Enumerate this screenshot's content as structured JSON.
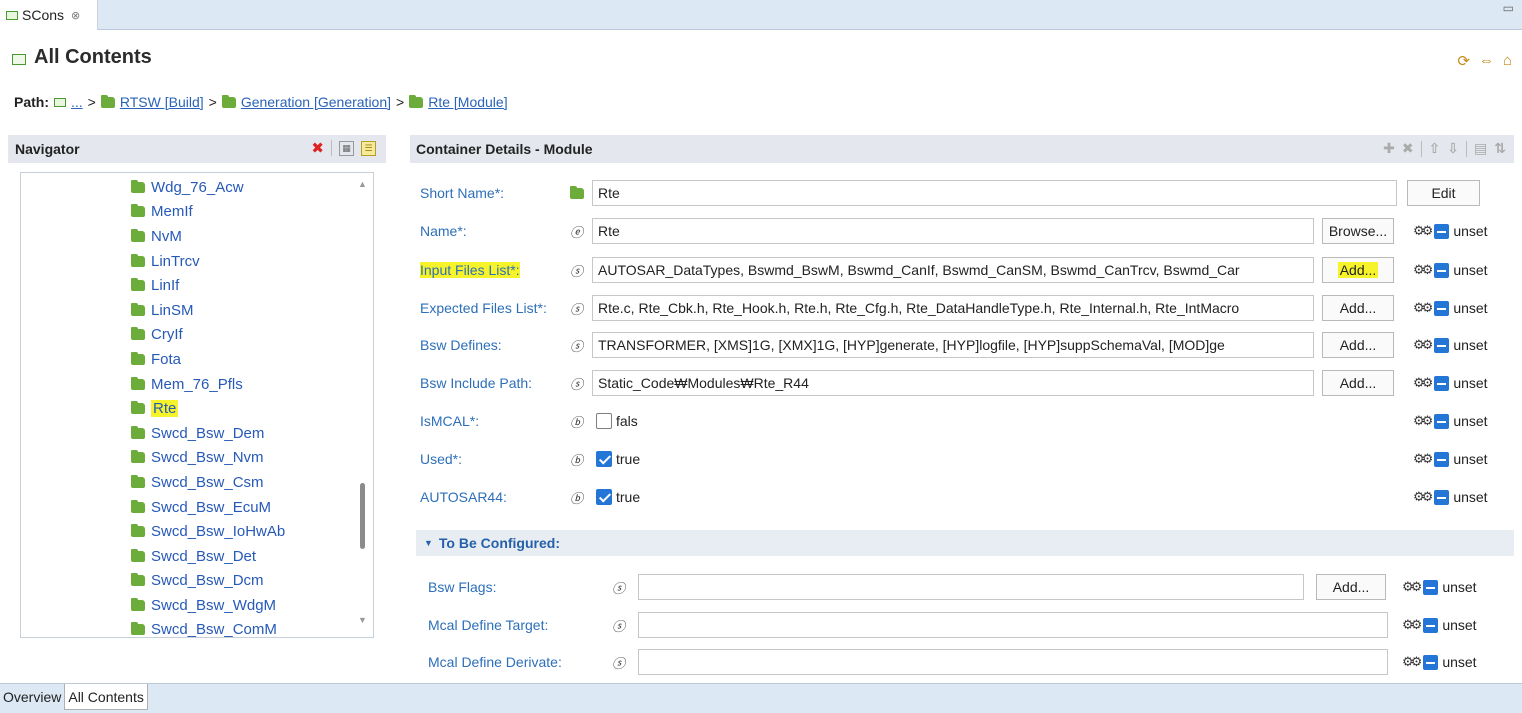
{
  "editor_tab": {
    "label": "SCons",
    "close": "⊗"
  },
  "title": "All Contents",
  "path": {
    "label": "Path:",
    "crumbs": [
      "...",
      "RTSW [Build]",
      "Generation [Generation]",
      "Rte [Module]"
    ],
    "separator": ">"
  },
  "navigator": {
    "title": "Navigator",
    "items": [
      "Wdg_76_Acw",
      "MemIf",
      "NvM",
      "LinTrcv",
      "LinIf",
      "LinSM",
      "CryIf",
      "Fota",
      "Mem_76_Pfls",
      "Rte",
      "Swcd_Bsw_Dem",
      "Swcd_Bsw_Nvm",
      "Swcd_Bsw_Csm",
      "Swcd_Bsw_EcuM",
      "Swcd_Bsw_IoHwAb",
      "Swcd_Bsw_Det",
      "Swcd_Bsw_Dcm",
      "Swcd_Bsw_WdgM",
      "Swcd_Bsw_ComM"
    ],
    "selected_index": 9
  },
  "details": {
    "title": "Container Details - Module",
    "unset_label": "unset",
    "fields": [
      {
        "label": "Short Name*:",
        "type_icon": "folder",
        "value": "Rte",
        "button": "Edit"
      },
      {
        "label": "Name*:",
        "type_icon": "ⓔ",
        "value": "Rte",
        "button": "Browse..."
      },
      {
        "label": "Input Files List*:",
        "type_icon": "ⓢ",
        "value": "AUTOSAR_DataTypes, Bswmd_BswM, Bswmd_CanIf, Bswmd_CanSM, Bswmd_CanTrcv, Bswmd_Car",
        "button": "Add..."
      },
      {
        "label": "Expected Files List*:",
        "type_icon": "ⓢ",
        "value": "Rte.c, Rte_Cbk.h, Rte_Hook.h, Rte.h, Rte_Cfg.h, Rte_DataHandleType.h, Rte_Internal.h, Rte_IntMacro",
        "button": "Add..."
      },
      {
        "label": "Bsw Defines:",
        "type_icon": "ⓢ",
        "value": "TRANSFORMER, [XMS]1G, [XMX]1G, [HYP]generate, [HYP]logfile, [HYP]suppSchemaVal, [MOD]ge",
        "button": "Add..."
      },
      {
        "label": "Bsw Include Path:",
        "type_icon": "ⓢ",
        "value": "Static_Code₩Modules₩Rte_R44",
        "button": "Add..."
      },
      {
        "label": "IsMCAL*:",
        "type_icon": "ⓑ",
        "checked": false,
        "value": "fals"
      },
      {
        "label": "Used*:",
        "type_icon": "ⓑ",
        "checked": true,
        "value": "true"
      },
      {
        "label": "AUTOSAR44:",
        "type_icon": "ⓑ",
        "checked": true,
        "value": "true"
      }
    ],
    "section": "To Be Configured:",
    "configured_fields": [
      {
        "label": "Bsw Flags:",
        "type_icon": "ⓢ",
        "value": "",
        "button": "Add..."
      },
      {
        "label": "Mcal Define Target:",
        "type_icon": "ⓢ",
        "value": ""
      },
      {
        "label": "Mcal Define Derivate:",
        "type_icon": "ⓢ",
        "value": ""
      }
    ]
  },
  "bottom_tabs": [
    "Overview",
    "All Contents"
  ],
  "colors": {
    "accent": "#2376d6",
    "link": "#2659b8",
    "highlight": "#f6f32a",
    "folder": "#6cac3a"
  }
}
